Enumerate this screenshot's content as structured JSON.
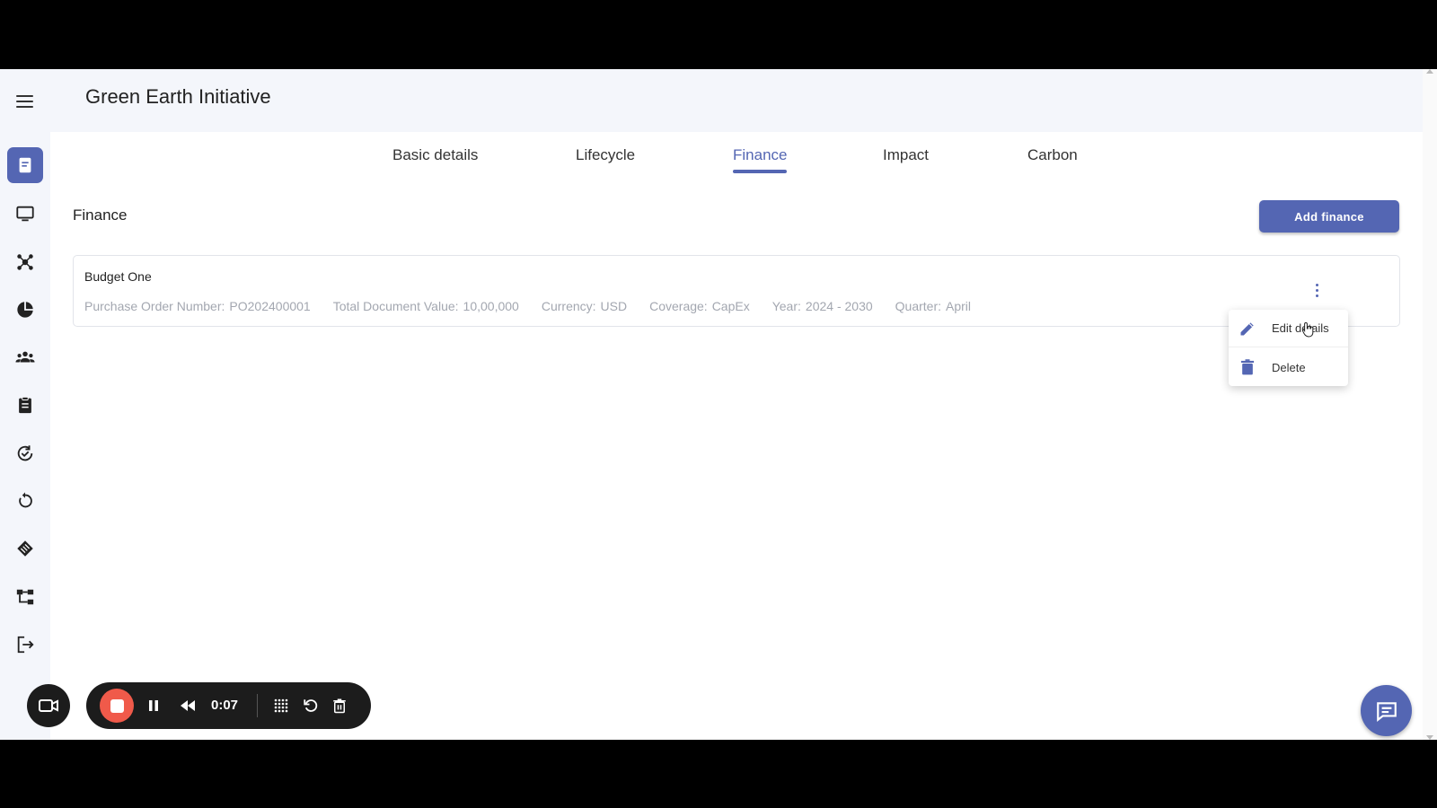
{
  "header": {
    "title": "Green Earth Initiative"
  },
  "tabs": [
    {
      "label": "Basic details",
      "active": false
    },
    {
      "label": "Lifecycle",
      "active": false
    },
    {
      "label": "Finance",
      "active": true
    },
    {
      "label": "Impact",
      "active": false
    },
    {
      "label": "Carbon",
      "active": false
    }
  ],
  "sidebar": {
    "icons": [
      "document-icon",
      "monitor-icon",
      "network-icon",
      "pie-chart-icon",
      "people-icon",
      "clipboard-icon",
      "check-cycle-icon",
      "refresh-icon",
      "tag-icon",
      "hierarchy-icon",
      "logout-icon"
    ]
  },
  "finance": {
    "section_title": "Finance",
    "add_button": "Add finance",
    "card": {
      "title": "Budget One",
      "fields": [
        {
          "label": "Purchase Order Number:",
          "value": "PO202400001"
        },
        {
          "label": "Total Document Value:",
          "value": "10,00,000"
        },
        {
          "label": "Currency:",
          "value": "USD"
        },
        {
          "label": "Coverage:",
          "value": "CapEx"
        },
        {
          "label": "Year:",
          "value": "2024 - 2030"
        },
        {
          "label": "Quarter:",
          "value": "April"
        }
      ]
    },
    "context_menu": {
      "edit_label": "Edit details",
      "delete_label": "Delete"
    }
  },
  "recorder": {
    "time": "0:07"
  },
  "colors": {
    "accent": "#5466b3",
    "record": "#f05a4a"
  }
}
